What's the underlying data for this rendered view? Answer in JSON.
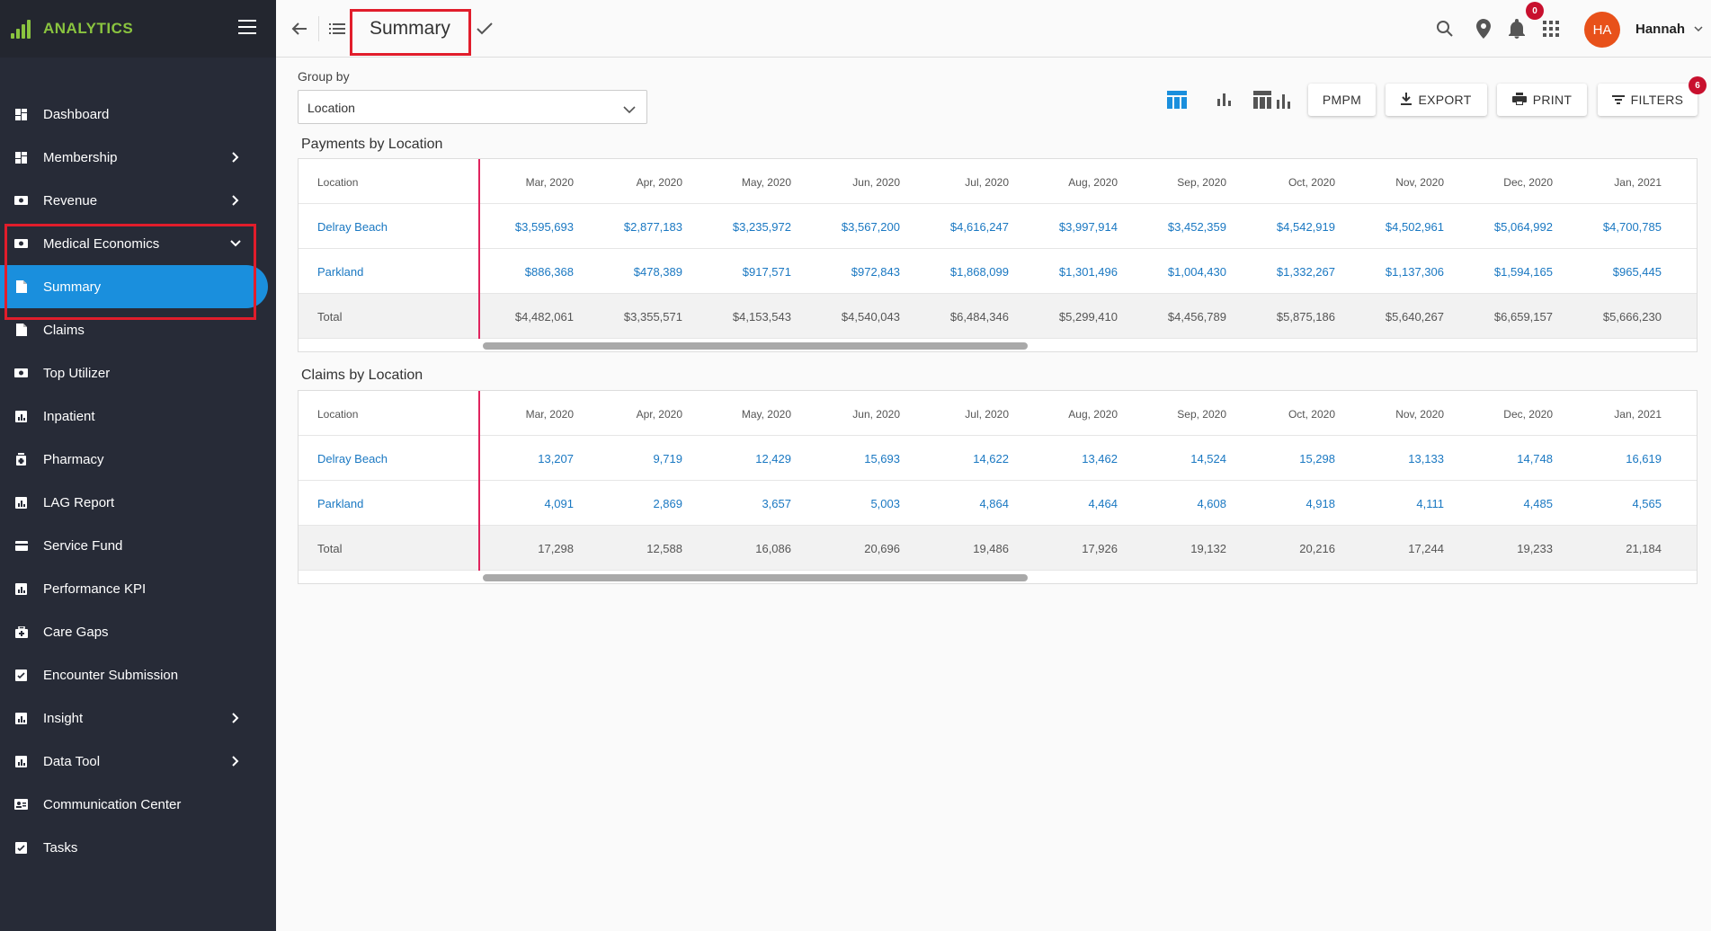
{
  "app": {
    "brand": "ANALYTICS"
  },
  "sidebar": {
    "items": [
      {
        "label": "Dashboard",
        "icon": "dashboard-icon",
        "chevron": ""
      },
      {
        "label": "Membership",
        "icon": "dashboard-icon",
        "chevron": "right"
      },
      {
        "label": "Revenue",
        "icon": "money-icon",
        "chevron": "right"
      },
      {
        "label": "Medical Economics",
        "icon": "money-icon",
        "chevron": "down"
      },
      {
        "label": "Summary",
        "icon": "document-icon",
        "chevron": "",
        "active": true
      },
      {
        "label": "Claims",
        "icon": "document-icon",
        "chevron": ""
      },
      {
        "label": "Top Utilizer",
        "icon": "money-icon",
        "chevron": ""
      },
      {
        "label": "Inpatient",
        "icon": "chart-icon",
        "chevron": ""
      },
      {
        "label": "Pharmacy",
        "icon": "pill-icon",
        "chevron": ""
      },
      {
        "label": "LAG Report",
        "icon": "chart-icon",
        "chevron": ""
      },
      {
        "label": "Service Fund",
        "icon": "card-icon",
        "chevron": ""
      },
      {
        "label": "Performance KPI",
        "icon": "chart-icon",
        "chevron": ""
      },
      {
        "label": "Care Gaps",
        "icon": "medkit-icon",
        "chevron": ""
      },
      {
        "label": "Encounter Submission",
        "icon": "checklist-icon",
        "chevron": ""
      },
      {
        "label": "Insight",
        "icon": "chart-icon",
        "chevron": "right"
      },
      {
        "label": "Data Tool",
        "icon": "chart-icon",
        "chevron": "right"
      },
      {
        "label": "Communication Center",
        "icon": "contact-card-icon",
        "chevron": ""
      },
      {
        "label": "Tasks",
        "icon": "checklist-icon",
        "chevron": ""
      }
    ]
  },
  "topbar": {
    "title": "Summary",
    "notification_count": "0",
    "avatar_initials": "HA",
    "username": "Hannah"
  },
  "controls": {
    "group_by_label": "Group by",
    "group_by_value": "Location",
    "pmpm_label": "PMPM",
    "export_label": "EXPORT",
    "print_label": "PRINT",
    "filters_label": "FILTERS",
    "filters_count": "6"
  },
  "colors": {
    "accent": "#1a8fdd",
    "brand": "#8ac43f",
    "highlight": "#e11d2b",
    "badge": "#c8102e",
    "avatar": "#e8511a",
    "link": "#1a78c2"
  },
  "payments": {
    "title": "Payments by Location",
    "location_header": "Location",
    "columns": [
      "Mar, 2020",
      "Apr, 2020",
      "May, 2020",
      "Jun, 2020",
      "Jul, 2020",
      "Aug, 2020",
      "Sep, 2020",
      "Oct, 2020",
      "Nov, 2020",
      "Dec, 2020",
      "Jan, 2021"
    ],
    "rows": [
      {
        "location": "Delray Beach",
        "link": true,
        "values": [
          "$3,595,693",
          "$2,877,183",
          "$3,235,972",
          "$3,567,200",
          "$4,616,247",
          "$3,997,914",
          "$3,452,359",
          "$4,542,919",
          "$4,502,961",
          "$5,064,992",
          "$4,700,785"
        ]
      },
      {
        "location": "Parkland",
        "link": true,
        "values": [
          "$886,368",
          "$478,389",
          "$917,571",
          "$972,843",
          "$1,868,099",
          "$1,301,496",
          "$1,004,430",
          "$1,332,267",
          "$1,137,306",
          "$1,594,165",
          "$965,445"
        ]
      },
      {
        "location": "Total",
        "link": false,
        "values": [
          "$4,482,061",
          "$3,355,571",
          "$4,153,543",
          "$4,540,043",
          "$6,484,346",
          "$5,299,410",
          "$4,456,789",
          "$5,875,186",
          "$5,640,267",
          "$6,659,157",
          "$5,666,230"
        ]
      }
    ]
  },
  "claims": {
    "title": "Claims by Location",
    "location_header": "Location",
    "columns": [
      "Mar, 2020",
      "Apr, 2020",
      "May, 2020",
      "Jun, 2020",
      "Jul, 2020",
      "Aug, 2020",
      "Sep, 2020",
      "Oct, 2020",
      "Nov, 2020",
      "Dec, 2020",
      "Jan, 2021"
    ],
    "rows": [
      {
        "location": "Delray Beach",
        "link": true,
        "values": [
          "13,207",
          "9,719",
          "12,429",
          "15,693",
          "14,622",
          "13,462",
          "14,524",
          "15,298",
          "13,133",
          "14,748",
          "16,619"
        ]
      },
      {
        "location": "Parkland",
        "link": true,
        "values": [
          "4,091",
          "2,869",
          "3,657",
          "5,003",
          "4,864",
          "4,464",
          "4,608",
          "4,918",
          "4,111",
          "4,485",
          "4,565"
        ]
      },
      {
        "location": "Total",
        "link": false,
        "values": [
          "17,298",
          "12,588",
          "16,086",
          "20,696",
          "19,486",
          "17,926",
          "19,132",
          "20,216",
          "17,244",
          "19,233",
          "21,184"
        ]
      }
    ]
  }
}
